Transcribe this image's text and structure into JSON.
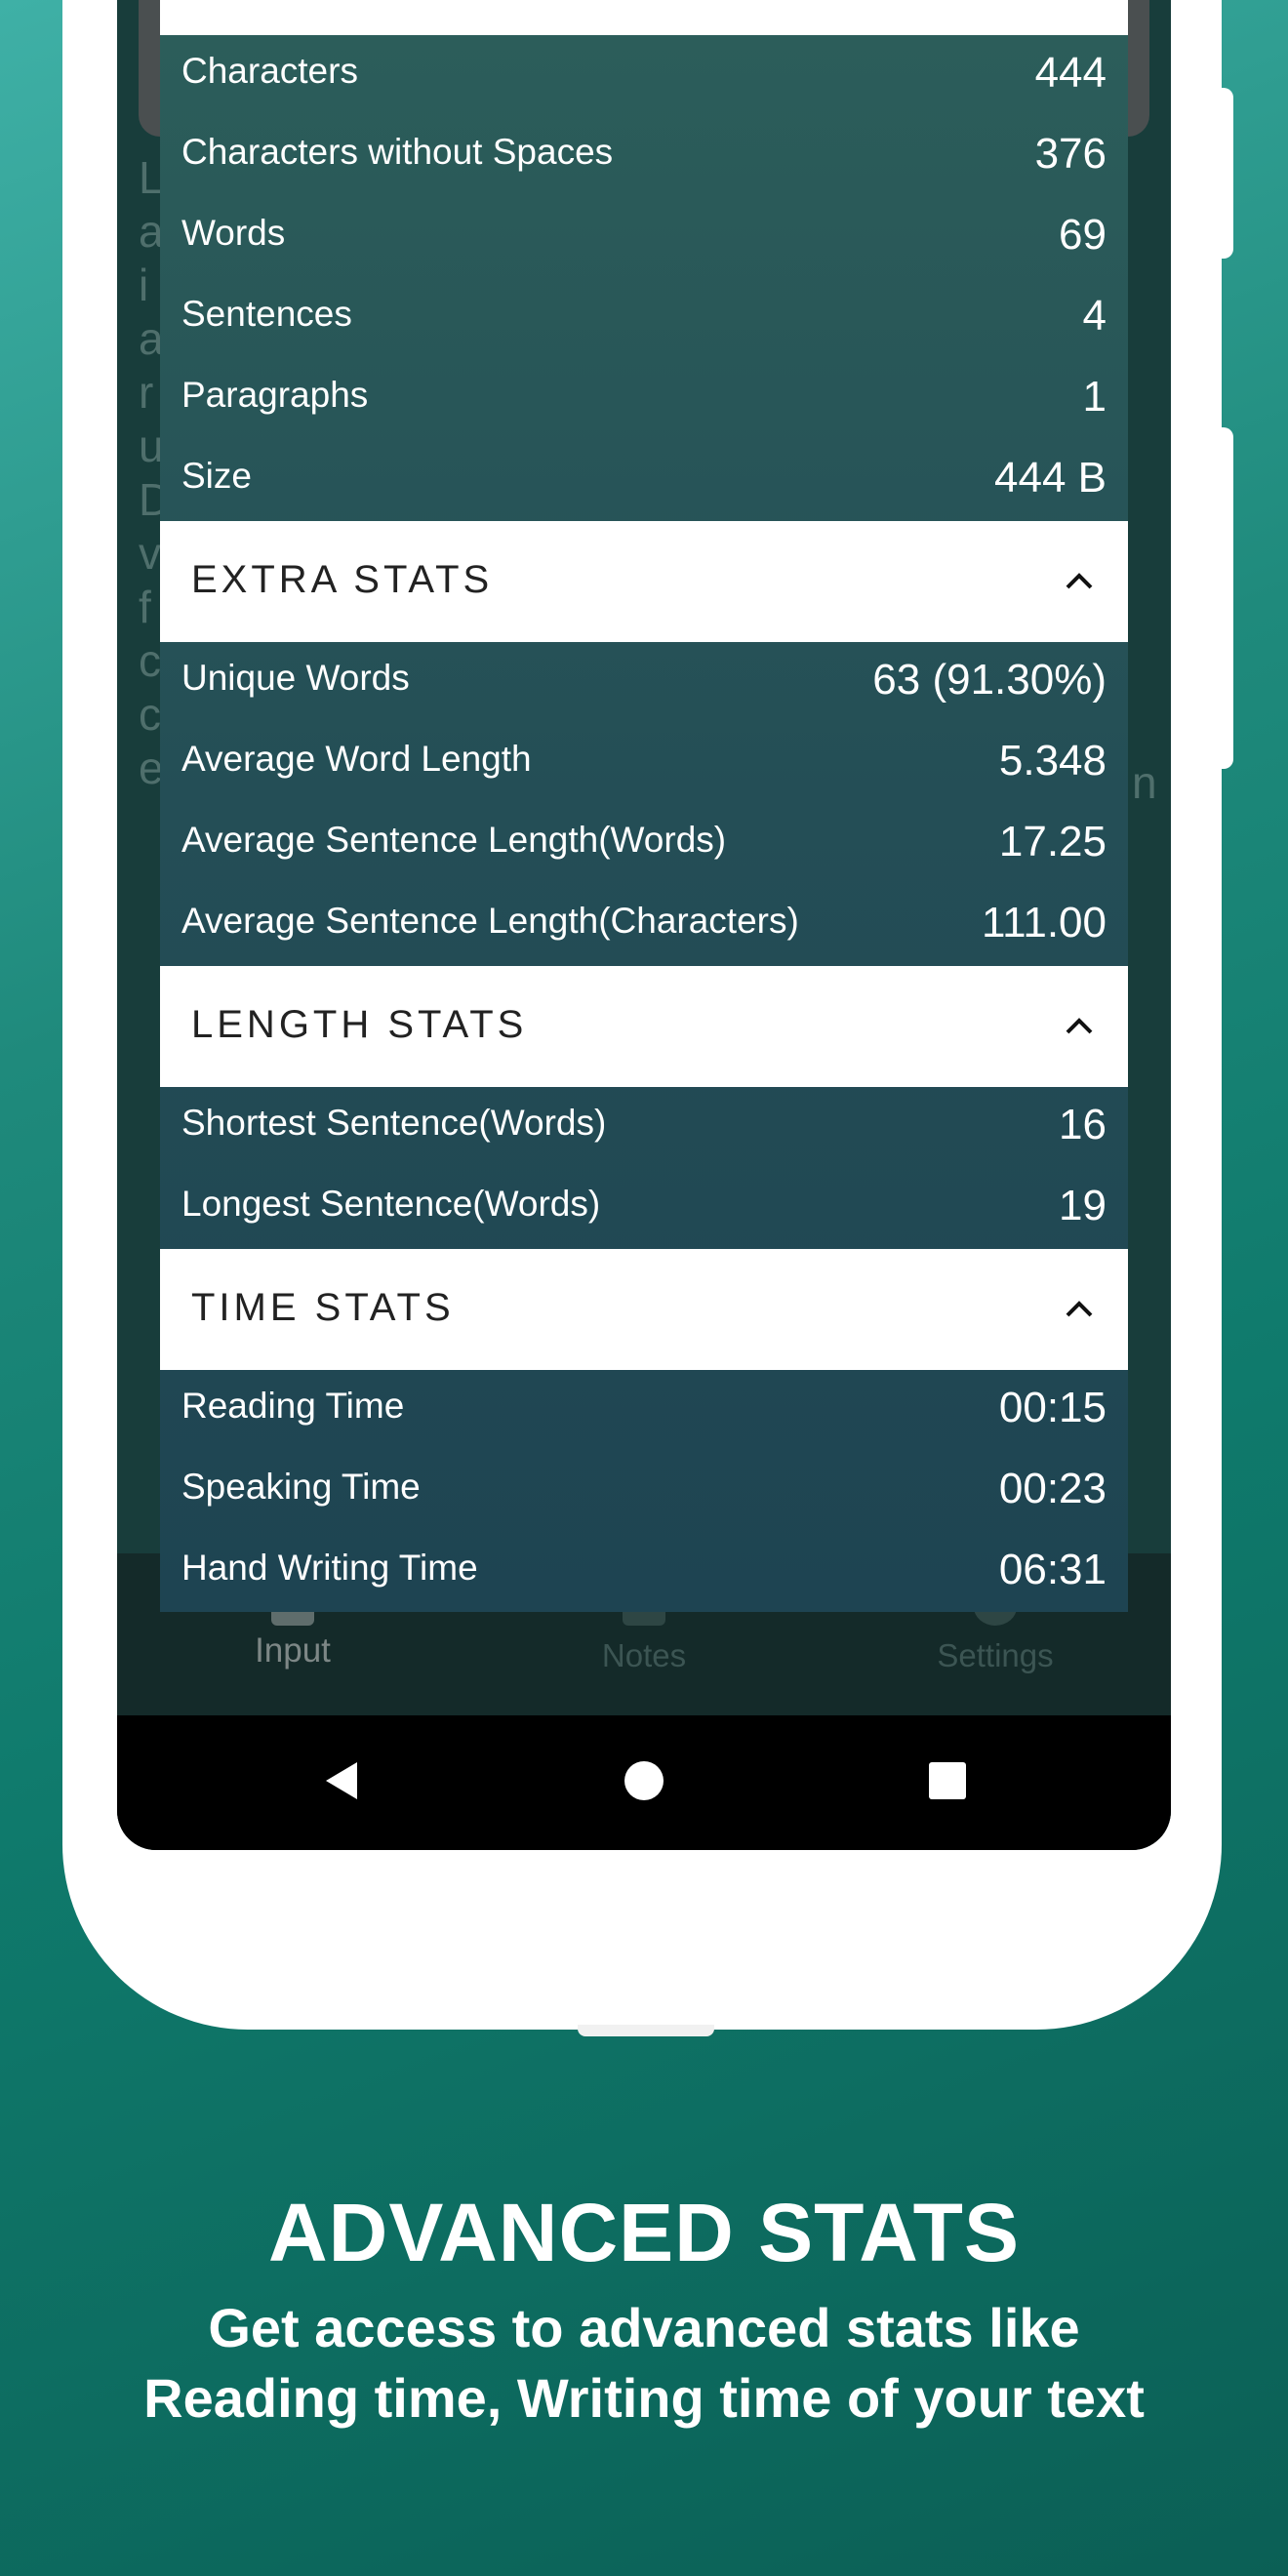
{
  "stats": {
    "basic": [
      {
        "label": "Characters",
        "value": "444"
      },
      {
        "label": "Characters without Spaces",
        "value": "376"
      },
      {
        "label": "Words",
        "value": "69"
      },
      {
        "label": "Sentences",
        "value": "4"
      },
      {
        "label": "Paragraphs",
        "value": "1"
      },
      {
        "label": "Size",
        "value": "444 B"
      }
    ],
    "extra": {
      "title": "EXTRA STATS",
      "rows": [
        {
          "label": "Unique Words",
          "value": "63 (91.30%)"
        },
        {
          "label": "Average Word Length",
          "value": "5.348"
        },
        {
          "label": "Average Sentence Length(Words)",
          "value": "17.25"
        },
        {
          "label": "Average Sentence Length(Characters)",
          "value": "111.00"
        }
      ]
    },
    "length": {
      "title": "LENGTH STATS",
      "rows": [
        {
          "label": "Shortest Sentence(Words)",
          "value": "16"
        },
        {
          "label": "Longest Sentence(Words)",
          "value": "19"
        }
      ]
    },
    "time": {
      "title": "TIME STATS",
      "rows": [
        {
          "label": "Reading Time",
          "value": "00:15"
        },
        {
          "label": "Speaking Time",
          "value": "00:23"
        },
        {
          "label": "Hand Writing Time",
          "value": "06:31"
        }
      ]
    }
  },
  "background_text": {
    "letters": [
      "L",
      "a",
      "i",
      "a",
      "r",
      "u",
      "D",
      "v",
      "f",
      "c",
      "c",
      "e"
    ],
    "right_letter": "n"
  },
  "bottom_nav": {
    "input": "Input",
    "notes": "Notes",
    "settings": "Settings"
  },
  "caption": {
    "title": "ADVANCED STATS",
    "line1": "Get access to advanced stats like",
    "line2": "Reading time, Writing time of your text"
  },
  "colors": {
    "background_top": "#3fb0a6",
    "background_bottom": "#0b5f55",
    "panel": "#244e56",
    "header": "#ffffff"
  }
}
